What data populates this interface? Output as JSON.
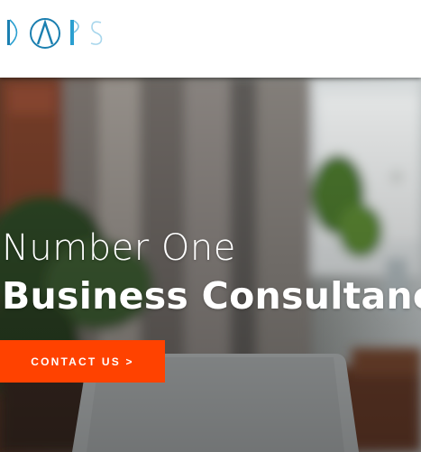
{
  "brand": {
    "logo_text": "DAPS",
    "colors": {
      "dark": "#1b7fb0",
      "mid": "#2a9fd0",
      "light": "#a8d6ec"
    }
  },
  "hero": {
    "headline_line1": "Number One",
    "headline_line2": "Business Consultancy",
    "cta_label": "CONTACT US >",
    "cta_color": "#ff4200",
    "background": "blurred office photo with plants, window and laptop"
  }
}
